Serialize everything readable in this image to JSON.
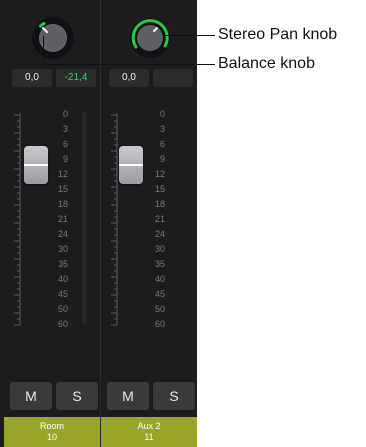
{
  "strips": [
    {
      "balance_value": "0,0",
      "peak_value": "-21,4",
      "mute_label": "M",
      "solo_label": "S",
      "track_name": "Room",
      "track_number": "10",
      "fader_level_db": "12"
    },
    {
      "balance_value": "0,0",
      "peak_value": "",
      "mute_label": "M",
      "solo_label": "S",
      "track_name": "Aux 2",
      "track_number": "11",
      "fader_level_db": "12"
    }
  ],
  "scale_ticks": [
    "0",
    "3",
    "6",
    "9",
    "12",
    "15",
    "18",
    "21",
    "24",
    "30",
    "35",
    "40",
    "45",
    "50",
    "60"
  ],
  "callouts": {
    "stereo_pan_knob": "Stereo Pan knob",
    "balance_knob": "Balance knob"
  },
  "colors": {
    "background": "#1c1c1e",
    "name_bar": "#9aa62a",
    "peak_green": "#35d06a",
    "knob_ring": "#23c94a"
  },
  "icons": {
    "balance": "knob-icon",
    "pan": "stereo-pan-knob-icon"
  }
}
